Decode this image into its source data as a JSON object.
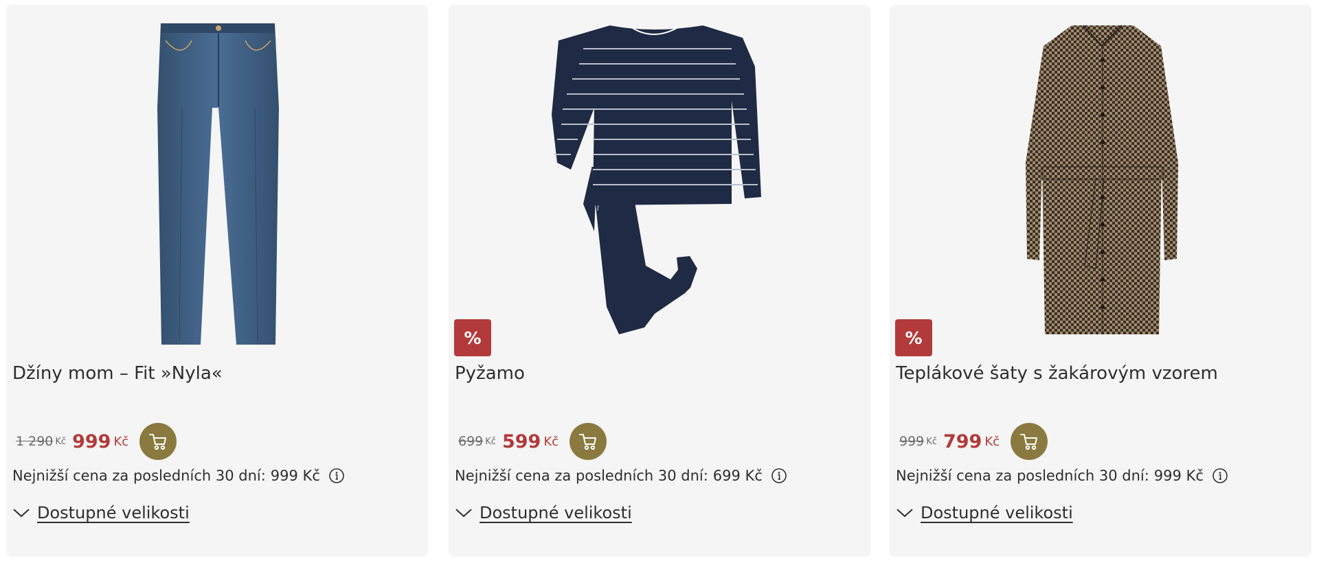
{
  "products": [
    {
      "title": "Džíny mom – Fit »Nyla«",
      "badge": "",
      "old_price": "1 290",
      "old_currency": "Kč",
      "new_price": "999",
      "new_currency": "Kč",
      "lowest_label": "Nejnižší cena za posledních 30 dní:",
      "lowest_value": "999 Kč",
      "sizes_label": "Dostupné velikosti",
      "image_icon": "jeans-image"
    },
    {
      "title": "Pyžamo",
      "badge": "%",
      "old_price": "699",
      "old_currency": "Kč",
      "new_price": "599",
      "new_currency": "Kč",
      "lowest_label": "Nejnižší cena za posledních 30 dní:",
      "lowest_value": "699 Kč",
      "sizes_label": "Dostupné velikosti",
      "image_icon": "pajamas-image"
    },
    {
      "title": "Teplákové šaty s žakárovým vzorem",
      "badge": "%",
      "old_price": "999",
      "old_currency": "Kč",
      "new_price": "799",
      "new_currency": "Kč",
      "lowest_label": "Nejnižší cena za posledních 30 dní:",
      "lowest_value": "999 Kč",
      "sizes_label": "Dostupné velikosti",
      "image_icon": "dress-image"
    }
  ],
  "colors": {
    "card_bg": "#f5f5f5",
    "sale_red": "#b33a3a",
    "cart_gold": "#8a7a3f",
    "denim": "#3e5f85",
    "navy": "#1f2a44",
    "houndstooth": "#6e5a43"
  }
}
